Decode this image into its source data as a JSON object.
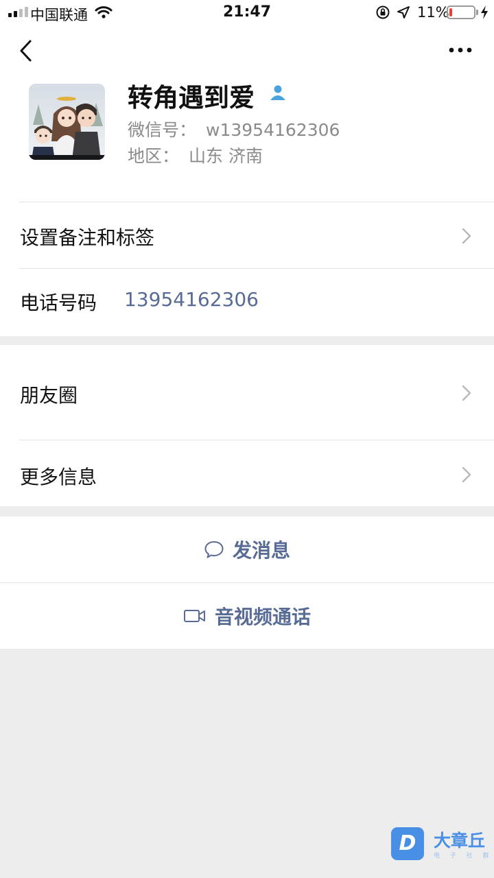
{
  "status_bar": {
    "carrier": "中国联通",
    "time": "21:47",
    "battery_pct": "11%",
    "battery_level": 0.11,
    "icons": [
      "cellular-signal-icon",
      "wifi-icon",
      "rotation-lock-icon",
      "location-arrow-icon",
      "battery-icon",
      "charging-bolt-icon"
    ]
  },
  "header": {
    "back_icon": "chevron-left-icon",
    "more_icon": "ellipsis-icon"
  },
  "profile": {
    "nickname": "转角遇到爱",
    "badge_icon": "person-icon",
    "wechat_id_label": "微信号：",
    "wechat_id": "w13954162306",
    "region_label": "地区：",
    "region": "山东 济南"
  },
  "cells": {
    "remark_tags": "设置备注和标签",
    "phone_label": "电话号码",
    "phone_value": "13954162306",
    "moments": "朋友圈",
    "more_info": "更多信息"
  },
  "actions": {
    "send_message": "发消息",
    "video_call": "音视频通话"
  },
  "watermark": {
    "logo_letter": "D",
    "name": "大章丘",
    "sub": "电 子 社 群"
  },
  "colors": {
    "link": "#576b95",
    "background": "#ededed",
    "badge": "#4aa3df",
    "watermark": "#4a8fe6"
  }
}
